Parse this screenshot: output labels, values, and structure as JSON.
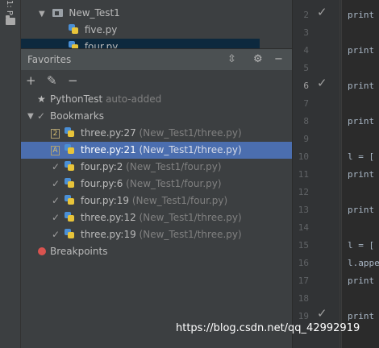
{
  "left_strip": {
    "label": "1: P"
  },
  "project_tree": {
    "items": [
      {
        "label": "New_Test1"
      },
      {
        "label": "five.py"
      },
      {
        "label": "four.py"
      }
    ]
  },
  "favorites": {
    "title": "Favorites",
    "header_icons": [
      "collapse-icon",
      "gear-icon",
      "minimize-icon"
    ],
    "toolbar_icons": [
      "add-icon",
      "edit-icon",
      "remove-icon"
    ],
    "project": {
      "name": "PythonTest",
      "note": "auto-added"
    },
    "bookmarks": {
      "label": "Bookmarks",
      "items": [
        {
          "mark": "2",
          "name": "three.py:27",
          "location": "(New_Test1/three.py)"
        },
        {
          "mark": "A",
          "name": "three.py:21",
          "location": "(New_Test1/three.py)",
          "selected": true
        },
        {
          "mark": "check",
          "name": "four.py:2",
          "location": "(New_Test1/four.py)"
        },
        {
          "mark": "check",
          "name": "four.py:6",
          "location": "(New_Test1/four.py)"
        },
        {
          "mark": "check",
          "name": "four.py:19",
          "location": "(New_Test1/four.py)"
        },
        {
          "mark": "check",
          "name": "three.py:12",
          "location": "(New_Test1/three.py)"
        },
        {
          "mark": "check",
          "name": "three.py:19",
          "location": "(New_Test1/three.py)"
        }
      ]
    },
    "breakpoints": {
      "label": "Breakpoints"
    }
  },
  "gutter": {
    "line_numbers": [
      "2",
      "3",
      "4",
      "5",
      "6",
      "7",
      "8",
      "9",
      "10",
      "11",
      "12",
      "13",
      "14",
      "15",
      "16",
      "17",
      "18",
      "19"
    ]
  },
  "editor": {
    "lines": [
      "print",
      "print",
      "print",
      "print",
      "l = [",
      "print",
      "print",
      "l = [",
      "l.appe",
      "print",
      "print"
    ]
  },
  "watermark": "https://blog.csdn.net/qq_42992919",
  "colors": {
    "selection": "#4b6eaf",
    "panel": "#3c3f41",
    "editor": "#2b2b2b",
    "breakpoint": "#d9534f"
  }
}
